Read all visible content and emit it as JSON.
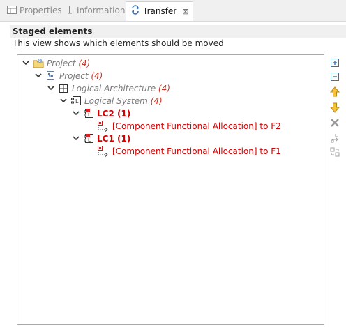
{
  "tabs": [
    {
      "label": "Properties",
      "icon": "properties-icon"
    },
    {
      "label": "Information",
      "icon": "info-icon"
    },
    {
      "label": "Transfer",
      "icon": "transfer-icon",
      "active": true,
      "close": "⊠"
    }
  ],
  "section": {
    "title": "Staged elements",
    "description": "This view shows which elements should be moved"
  },
  "tree": [
    {
      "label": "Project",
      "count": "(4)"
    },
    {
      "label": "Project",
      "count": "(4)"
    },
    {
      "label": "Logical Architecture",
      "count": "(4)"
    },
    {
      "label": "Logical System",
      "count": "(4)"
    },
    {
      "label": "LC2 (1)"
    },
    {
      "label": "[Component Functional Allocation] to F2"
    },
    {
      "label": "LC1 (1)"
    },
    {
      "label": "[Component Functional Allocation] to F1"
    }
  ],
  "toolbar": [
    "expand-all-icon",
    "collapse-all-icon",
    "move-up-icon",
    "move-down-icon",
    "remove-icon",
    "transfer-icon",
    "sync-icon"
  ],
  "colors": {
    "accent_red": "#d40000",
    "inactive_text": "#7a7a7a",
    "tab_bar": "#f0f0f0"
  }
}
